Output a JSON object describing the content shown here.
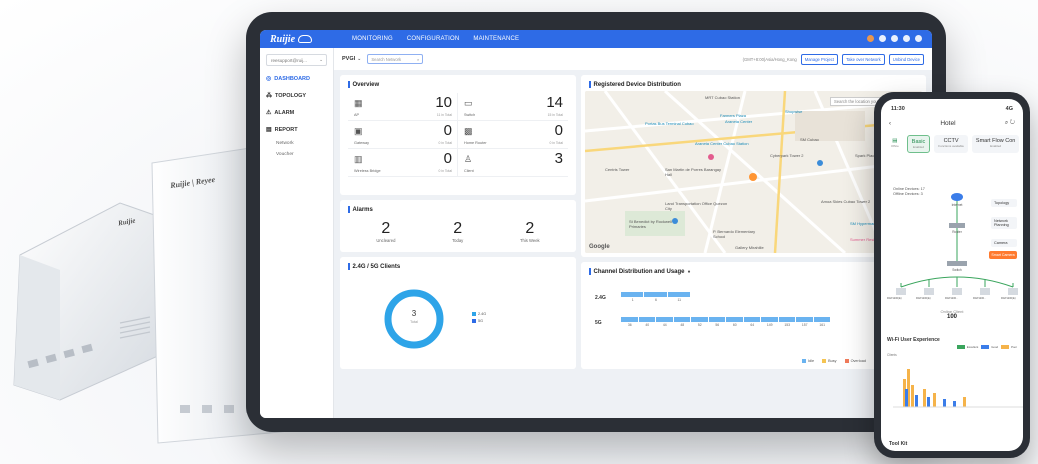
{
  "nav": {
    "logo": "Ruijie",
    "tabs": [
      "MONITORING",
      "CONFIGURATION",
      "MAINTENANCE"
    ]
  },
  "sidebar": {
    "account": "reesupport@ruij...",
    "items": [
      {
        "label": "DASHBOARD",
        "icon": "dashboard-icon"
      },
      {
        "label": "TOPOLOGY",
        "icon": "topology-icon"
      },
      {
        "label": "ALARM",
        "icon": "alarm-icon"
      },
      {
        "label": "REPORT",
        "icon": "report-icon"
      }
    ],
    "subitems": [
      "Network",
      "Voucher"
    ]
  },
  "toolbar": {
    "project": "PVGI",
    "search_placeholder": "Search Network",
    "sn_text": "(GMT+8:00)Asia/Hong_Kong",
    "buttons": [
      "Manage Project",
      "Take over Network",
      "Unbind Device"
    ]
  },
  "overview": {
    "title": "Overview",
    "cells": [
      {
        "name": "AP",
        "value": "10",
        "sub": "11 in Total"
      },
      {
        "name": "Switch",
        "value": "14",
        "sub": "15 in Total"
      },
      {
        "name": "Gateway",
        "value": "0",
        "sub": "0 in Total"
      },
      {
        "name": "Home Router",
        "value": "0",
        "sub": "0 in Total"
      },
      {
        "name": "Wireless Bridge",
        "value": "0",
        "sub": "0 in Total"
      },
      {
        "name": "Client",
        "value": "3",
        "sub": ""
      }
    ]
  },
  "alarms": {
    "title": "Alarms",
    "items": [
      {
        "value": "2",
        "label": "Uncleared"
      },
      {
        "value": "2",
        "label": "Today"
      },
      {
        "value": "2",
        "label": "This Week"
      }
    ]
  },
  "clients": {
    "title": "2.4G / 5G Clients",
    "total": "3",
    "total_label": "Total",
    "legend": [
      "2.4G",
      "5G"
    ]
  },
  "map": {
    "title": "Registered Device Distribution",
    "search_placeholder": "Search the location you need",
    "labels": [
      "MRT Cubao Station",
      "Farmers Plaza",
      "Araneta Center",
      "Portas Bus Terminal Cubao",
      "Araneta Center Cubao Station",
      "Cyberpark Tower 2",
      "SM Cubao",
      "Centris Tower",
      "San Martin de Porres Barangay Hall",
      "Land Transportation Office Quezon City",
      "Amoa Skies Cubao Tower 2",
      "P. Bernardo Elementary School",
      "Gallery Mirahille",
      "St Benedict by Rockwell Primaries",
      "Spark Place",
      "Ali Mall",
      "Shopwise",
      "SM Hypermart",
      "Summer Residences"
    ],
    "google": "Google"
  },
  "channel": {
    "title": "Channel Distribution and Usage",
    "band_24": "2.4G",
    "band_5": "5G",
    "channels_24": [
      "1",
      "6",
      "11"
    ],
    "channels_5": [
      "36",
      "40",
      "44",
      "48",
      "52",
      "56",
      "60",
      "64",
      "149",
      "153",
      "157",
      "161"
    ],
    "legend": [
      "Idle",
      "Busy",
      "Overload"
    ]
  },
  "phone": {
    "time": "11:30",
    "signal": "4G",
    "title": "Hotel",
    "scenarios": [
      {
        "label": "Basic",
        "sub": "Enabled"
      },
      {
        "label": "CCTV",
        "sub": "Functions available"
      },
      {
        "label": "Smart Flow Con",
        "sub": "Enabled"
      }
    ],
    "office_label": "Office",
    "online_devices": "Online Devices: 17",
    "offline_devices": "Offline Devices: 3",
    "nodes": [
      "Internet",
      "Router",
      "Switch"
    ],
    "side_buttons": [
      "Topology",
      "Network Planning",
      "Camera"
    ],
    "orange_button": "Smart Camera",
    "ap_labels": [
      "RAP1200(E)",
      "RAP1200(E)",
      "RAP1200..",
      "RAP1200..",
      "RAP1200(E)"
    ],
    "online_client_label": "Online Client",
    "online_client_value": "100",
    "wifi_title": "Wi-Fi User Experience",
    "wifi_legend": [
      "Excellent",
      "Good",
      "Poor"
    ],
    "clients_label": "Clients",
    "toolkit": "Tool Kit"
  },
  "hardware": {
    "brand_front": "Ruijie | Reyee",
    "brand_back": "Ruijie"
  },
  "colors": {
    "accent": "#2e6be6",
    "donut": "#2ea4e8",
    "orange": "#ff7a2f",
    "green": "#3aa55d"
  }
}
